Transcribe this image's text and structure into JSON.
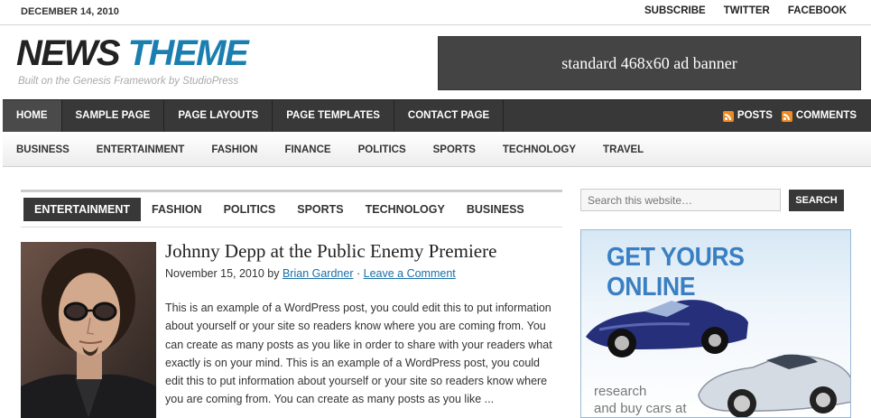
{
  "topbar": {
    "date": "DECEMBER 14, 2010",
    "links": [
      "SUBSCRIBE",
      "TWITTER",
      "FACEBOOK"
    ]
  },
  "header": {
    "logo_word1": "NEWS",
    "logo_word2": "THEME",
    "tagline": "Built on the Genesis Framework by StudioPress",
    "ad_banner": "standard 468x60 ad banner"
  },
  "primary_nav": {
    "items": [
      "HOME",
      "SAMPLE PAGE",
      "PAGE LAYOUTS",
      "PAGE TEMPLATES",
      "CONTACT PAGE"
    ],
    "posts_label": "POSTS",
    "comments_label": "COMMENTS"
  },
  "secondary_nav": {
    "items": [
      "BUSINESS",
      "ENTERTAINMENT",
      "FASHION",
      "FINANCE",
      "POLITICS",
      "SPORTS",
      "TECHNOLOGY",
      "TRAVEL"
    ]
  },
  "tabs": {
    "items": [
      "ENTERTAINMENT",
      "FASHION",
      "POLITICS",
      "SPORTS",
      "TECHNOLOGY",
      "BUSINESS"
    ]
  },
  "post": {
    "title": "Johnny Depp at the Public Enemy Premiere",
    "date": "November 15, 2010",
    "by": "by",
    "author": "Brian Gardner",
    "separator": "·",
    "comment_link": "Leave a Comment",
    "body": "This is an example of a WordPress post, you could edit this to put information about yourself or your site so readers know where you are coming from. You can create as many posts as you like in order to share with your readers what exactly is on your mind. This is an example of a WordPress post, you could edit this to put information about yourself or your site so readers know where you are coming from. You can create as many posts as you like ..."
  },
  "sidebar": {
    "search_placeholder": "Search this website…",
    "search_button": "SEARCH",
    "ad_headline": "GET YOURS ONLINE",
    "ad_line1": "research",
    "ad_line2": "and buy cars at"
  },
  "colors": {
    "accent_blue": "#1a7fb0",
    "nav_dark": "#383838"
  }
}
